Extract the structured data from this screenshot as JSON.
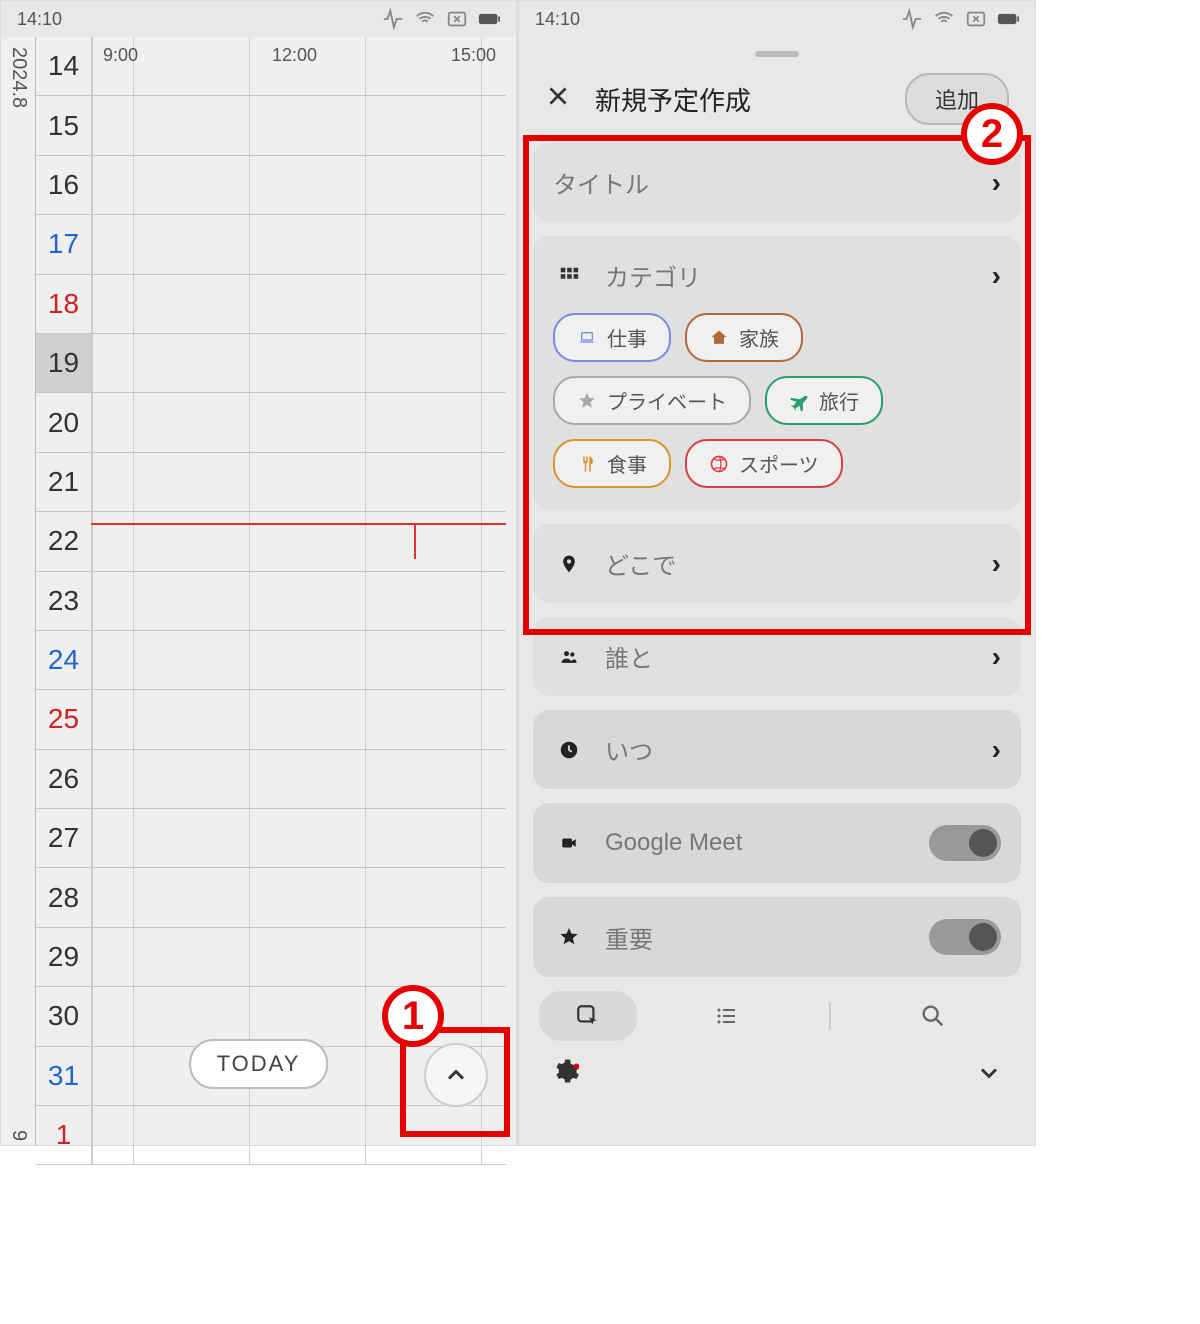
{
  "statusbar": {
    "time": "14:10"
  },
  "left": {
    "year_month": "2024.8",
    "next_month": "9",
    "time_slots": [
      "9:00",
      "12:00",
      "15:00"
    ],
    "days": [
      {
        "num": "14",
        "cls": ""
      },
      {
        "num": "15",
        "cls": ""
      },
      {
        "num": "16",
        "cls": ""
      },
      {
        "num": "17",
        "cls": "sat"
      },
      {
        "num": "18",
        "cls": "sun"
      },
      {
        "num": "19",
        "cls": "",
        "sel": true
      },
      {
        "num": "20",
        "cls": ""
      },
      {
        "num": "21",
        "cls": ""
      },
      {
        "num": "22",
        "cls": ""
      },
      {
        "num": "23",
        "cls": ""
      },
      {
        "num": "24",
        "cls": "sat"
      },
      {
        "num": "25",
        "cls": "sun"
      },
      {
        "num": "26",
        "cls": ""
      },
      {
        "num": "27",
        "cls": ""
      },
      {
        "num": "28",
        "cls": ""
      },
      {
        "num": "29",
        "cls": ""
      },
      {
        "num": "30",
        "cls": ""
      },
      {
        "num": "31",
        "cls": "sat"
      },
      {
        "num": "1",
        "cls": "sun"
      }
    ],
    "today_label": "TODAY"
  },
  "right": {
    "title": "新規予定作成",
    "add_label": "追加",
    "rows": {
      "title_label": "タイトル",
      "category_label": "カテゴリ",
      "location_label": "どこで",
      "people_label": "誰と",
      "when_label": "いつ",
      "meet_label": "Google Meet",
      "important_label": "重要"
    },
    "chips": [
      {
        "label": "仕事",
        "color": "#7a8ae0",
        "icon": "laptop"
      },
      {
        "label": "家族",
        "color": "#b06a3a",
        "icon": "home"
      },
      {
        "label": "プライベート",
        "color": "#aaaaaa",
        "icon": "star"
      },
      {
        "label": "旅行",
        "color": "#2a9d6a",
        "icon": "plane"
      },
      {
        "label": "食事",
        "color": "#d89430",
        "icon": "utensils"
      },
      {
        "label": "スポーツ",
        "color": "#d84040",
        "icon": "ball"
      }
    ]
  },
  "annotations": {
    "1": "1",
    "2": "2"
  }
}
